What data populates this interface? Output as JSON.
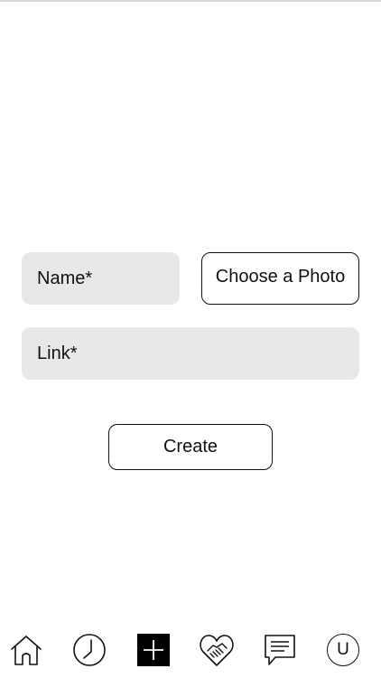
{
  "form": {
    "name_placeholder": "Name*",
    "photo_button_label": "Choose a Photo",
    "link_placeholder": "Link*",
    "create_button_label": "Create"
  },
  "tabbar": {
    "items": [
      {
        "icon": "home-icon",
        "label": ""
      },
      {
        "icon": "clock-icon",
        "label": ""
      },
      {
        "icon": "plus-icon",
        "label": "",
        "active": true
      },
      {
        "icon": "heart-handshake-icon",
        "label": ""
      },
      {
        "icon": "chat-icon",
        "label": ""
      },
      {
        "icon": "user-icon",
        "label": "U"
      }
    ]
  },
  "colors": {
    "field_bg": "#e8e8e8",
    "text": "#111111",
    "active_tab_bg": "#000000",
    "background": "#ffffff"
  }
}
